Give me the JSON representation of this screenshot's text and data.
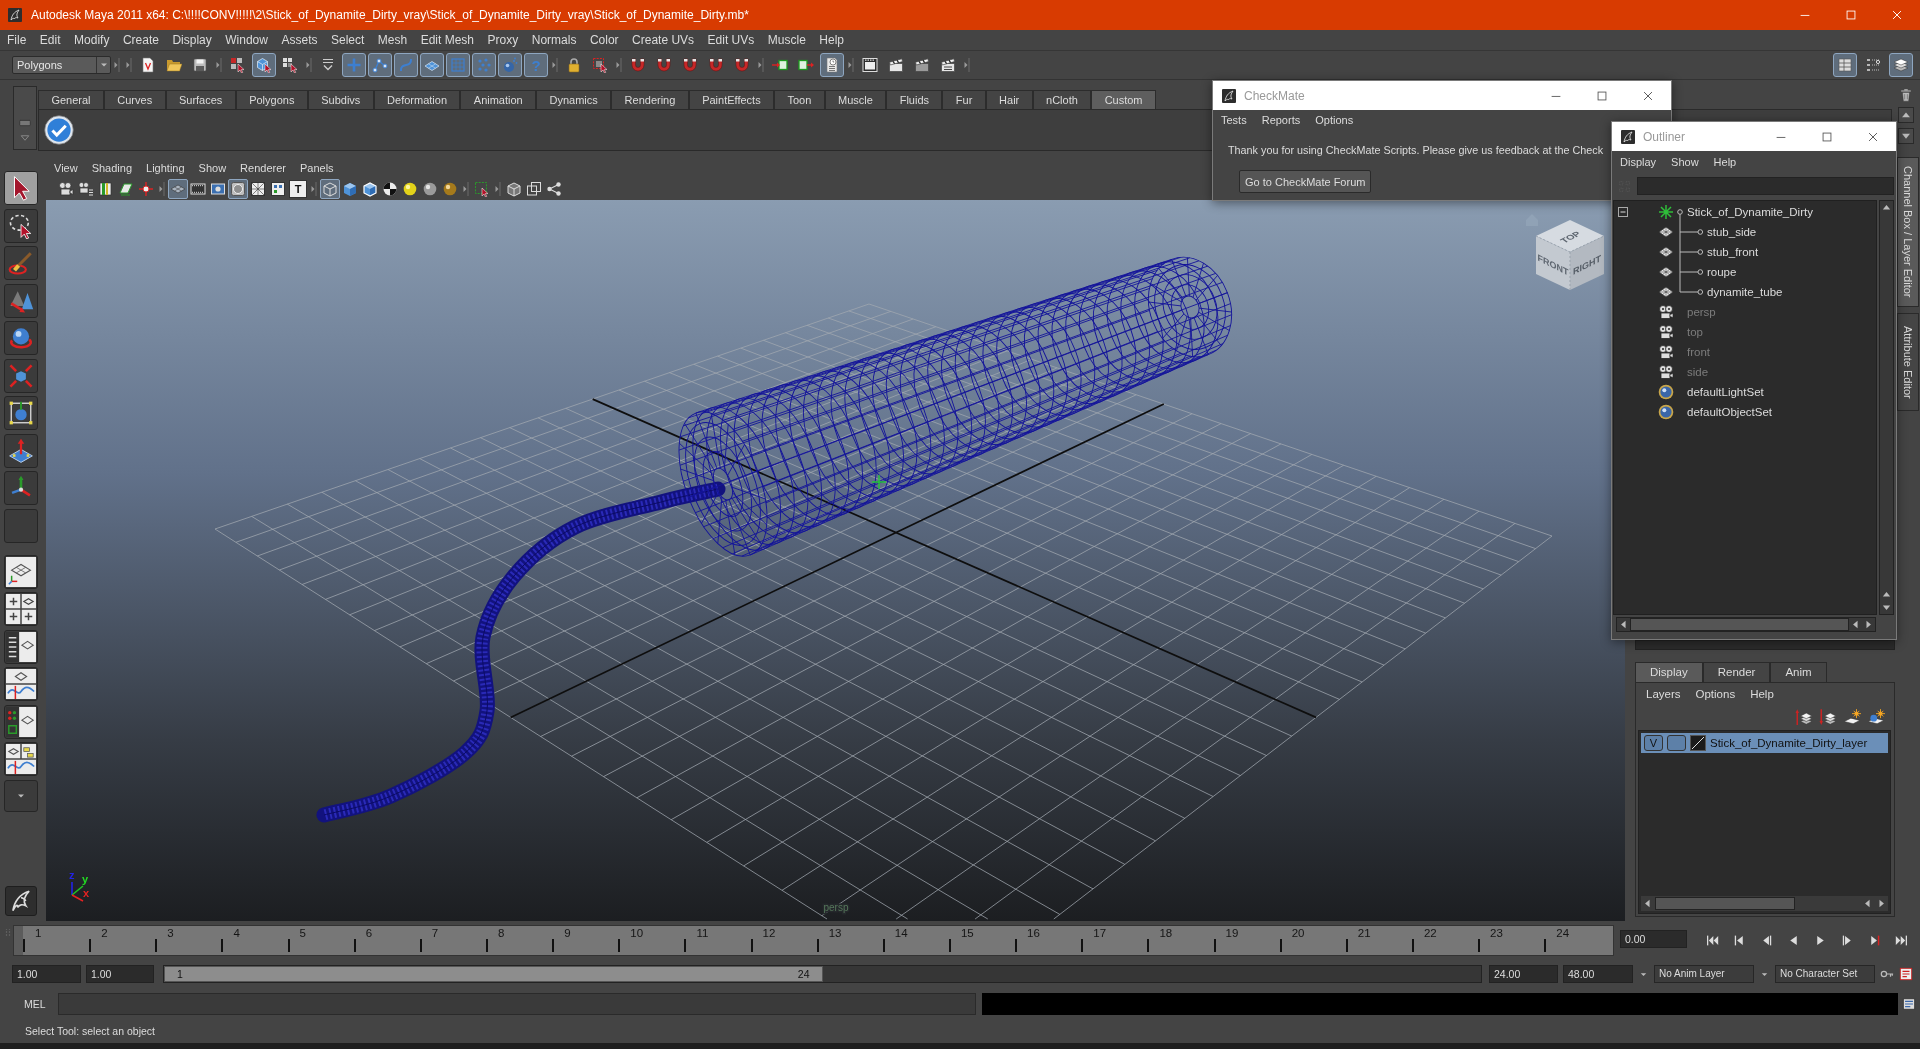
{
  "window": {
    "title": "Autodesk Maya 2011 x64: C:\\!!!!CONV!!!!!\\2\\Stick_of_Dynamite_Dirty_vray\\Stick_of_Dynamite_Dirty_vray\\Stick_of_Dynamite_Dirty.mb*"
  },
  "menu_bar": [
    "File",
    "Edit",
    "Modify",
    "Create",
    "Display",
    "Window",
    "Assets",
    "Select",
    "Mesh",
    "Edit Mesh",
    "Proxy",
    "Normals",
    "Color",
    "Create UVs",
    "Edit UVs",
    "Muscle",
    "Help"
  ],
  "status_line": {
    "menu_set": "Polygons",
    "buttons": [
      {
        "on": false
      },
      {
        "on": false
      },
      {
        "on": false
      },
      {
        "on": false
      },
      {
        "on": true
      },
      {
        "on": false
      },
      {
        "on": false
      },
      {
        "on": true
      },
      {
        "on": true
      },
      {
        "on": true
      },
      {
        "on": true
      },
      {
        "on": true
      },
      {
        "on": true
      },
      {
        "on": true
      },
      {
        "on": true,
        "label": "?"
      },
      {
        "on": false
      },
      {
        "on": false
      },
      {
        "on": false
      },
      {
        "on": false
      },
      {
        "on": false
      },
      {
        "on": false
      },
      {
        "on": false
      },
      {
        "on": false
      },
      {
        "on": false
      },
      {
        "on": true
      },
      {
        "on": false
      },
      {
        "on": false
      },
      {
        "on": false
      },
      {
        "on": false
      }
    ],
    "panel_buttons": [
      {
        "on": true
      },
      {
        "on": false
      },
      {
        "on": true
      }
    ]
  },
  "shelf": {
    "tabs": [
      {
        "label": "General",
        "selected": false
      },
      {
        "label": "Curves",
        "selected": false
      },
      {
        "label": "Surfaces",
        "selected": false
      },
      {
        "label": "Polygons",
        "selected": false
      },
      {
        "label": "Subdivs",
        "selected": false
      },
      {
        "label": "Deformation",
        "selected": false
      },
      {
        "label": "Animation",
        "selected": false
      },
      {
        "label": "Dynamics",
        "selected": false
      },
      {
        "label": "Rendering",
        "selected": false
      },
      {
        "label": "PaintEffects",
        "selected": false
      },
      {
        "label": "Toon",
        "selected": false
      },
      {
        "label": "Muscle",
        "selected": false
      },
      {
        "label": "Fluids",
        "selected": false
      },
      {
        "label": "Fur",
        "selected": false
      },
      {
        "label": "Hair",
        "selected": false
      },
      {
        "label": "nCloth",
        "selected": false
      },
      {
        "label": "Custom",
        "selected": true
      }
    ]
  },
  "toolbox": {
    "tools": [
      {
        "selected": true
      },
      {
        "selected": false
      },
      {
        "selected": false
      },
      {
        "selected": false
      },
      {
        "selected": false
      },
      {
        "selected": false
      },
      {
        "selected": false
      },
      {
        "selected": false
      },
      {
        "selected": false
      },
      {
        "selected": false
      }
    ]
  },
  "viewport": {
    "menus": [
      "View",
      "Shading",
      "Lighting",
      "Show",
      "Renderer",
      "Panels"
    ],
    "toolbar": [
      {
        "on": false
      },
      {
        "on": false
      },
      {
        "on": false
      },
      {
        "on": false
      },
      {
        "on": false
      },
      {
        "on": true
      },
      {
        "on": false
      },
      {
        "on": false
      },
      {
        "on": true
      },
      {
        "on": false
      },
      {
        "on": false
      },
      {
        "on": false,
        "label": "T"
      },
      {
        "on": true
      },
      {
        "on": false
      },
      {
        "on": false
      },
      {
        "on": false
      },
      {
        "on": false
      },
      {
        "on": false
      },
      {
        "on": false
      },
      {
        "on": false
      },
      {
        "on": false
      },
      {
        "on": false
      },
      {
        "on": false
      }
    ],
    "view_cube_labels": [
      "TOP",
      "FRONT",
      "RIGHT"
    ],
    "axis_labels": [
      {
        "label": "z",
        "color": "#2323e6"
      },
      {
        "label": "y",
        "color": "#22dd22"
      },
      {
        "label": "x",
        "color": "#e62222"
      }
    ],
    "camera_name": "persp"
  },
  "checkmate_window": {
    "title": "CheckMate",
    "menus": [
      "Tests",
      "Reports",
      "Options"
    ],
    "message": "Thank you for using CheckMate Scripts. Please give us feedback at the Check",
    "button": "Go to CheckMate Forum"
  },
  "outliner_window": {
    "title": "Outliner",
    "menus": [
      "Display",
      "Show",
      "Help"
    ],
    "items": [
      {
        "name": "Stick_of_Dynamite_Dirty",
        "kind": "group",
        "hidden": false,
        "expanded": true,
        "children": [
          {
            "name": "stub_side",
            "kind": "mesh",
            "hidden": false
          },
          {
            "name": "stub_front",
            "kind": "mesh",
            "hidden": false
          },
          {
            "name": "roupe",
            "kind": "mesh",
            "hidden": false
          },
          {
            "name": "dynamite_tube",
            "kind": "mesh",
            "hidden": false
          }
        ]
      },
      {
        "name": "persp",
        "kind": "camera",
        "hidden": true
      },
      {
        "name": "top",
        "kind": "camera",
        "hidden": true
      },
      {
        "name": "front",
        "kind": "camera",
        "hidden": true
      },
      {
        "name": "side",
        "kind": "camera",
        "hidden": true
      },
      {
        "name": "defaultLightSet",
        "kind": "set",
        "hidden": false
      },
      {
        "name": "defaultObjectSet",
        "kind": "set",
        "hidden": false
      }
    ]
  },
  "side_tabs": [
    {
      "label": "Channel Box / Layer Editor",
      "selected": true
    },
    {
      "label": "Attribute Editor",
      "selected": false
    }
  ],
  "layer_editor": {
    "tabs": [
      {
        "label": "Display",
        "selected": true
      },
      {
        "label": "Render",
        "selected": false
      },
      {
        "label": "Anim",
        "selected": false
      }
    ],
    "menus": [
      "Layers",
      "Options",
      "Help"
    ],
    "layers": [
      {
        "visibility": "V",
        "name": "Stick_of_Dynamite_Dirty_layer",
        "selected": true
      }
    ]
  },
  "time_slider": {
    "frames": [
      "1",
      "2",
      "3",
      "4",
      "5",
      "6",
      "7",
      "8",
      "9",
      "10",
      "11",
      "12",
      "13",
      "14",
      "15",
      "16",
      "17",
      "18",
      "19",
      "20",
      "21",
      "22",
      "23",
      "24"
    ],
    "level": 0,
    "current_time": "0.00"
  },
  "range_slider": {
    "start_time": "1.00",
    "playback_start": "1.00",
    "handle_start": "1",
    "handle_end": "24",
    "level": 0.5,
    "playback_end": "24.00",
    "end_time": "48.00",
    "anim_layer": "No Anim Layer",
    "character_set": "No Character Set"
  },
  "command_line": {
    "language": "MEL"
  },
  "help_line": {
    "text": "Select Tool: select an object"
  }
}
